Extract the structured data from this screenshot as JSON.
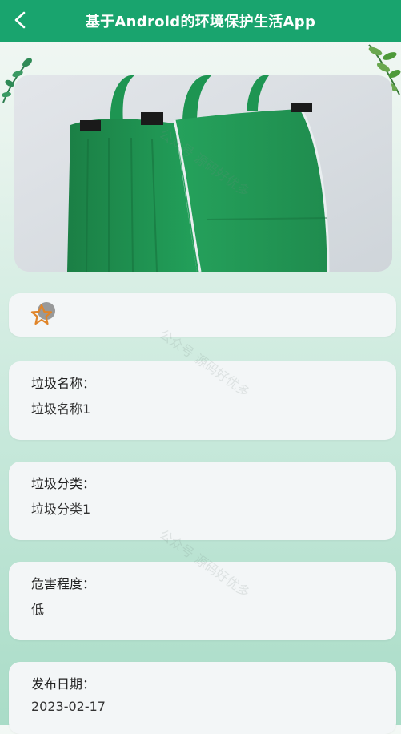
{
  "header": {
    "title": "基于Android的环境保护生活App",
    "back_icon": "chevron-left-icon"
  },
  "favorite": {
    "icon": "star-icon",
    "accent": "#e0852a"
  },
  "fields": [
    {
      "label": "垃圾名称：",
      "value": "垃圾名称1"
    },
    {
      "label": "垃圾分类：",
      "value": "垃圾分类1"
    },
    {
      "label": "危害程度：",
      "value": "低"
    },
    {
      "label": "发布日期：",
      "value": "2023-02-17"
    }
  ],
  "watermark": {
    "text": "公众号 源码好优多"
  },
  "colors": {
    "primary": "#19a46e",
    "card": "#f3f6f7",
    "product": "#1f9a55"
  }
}
